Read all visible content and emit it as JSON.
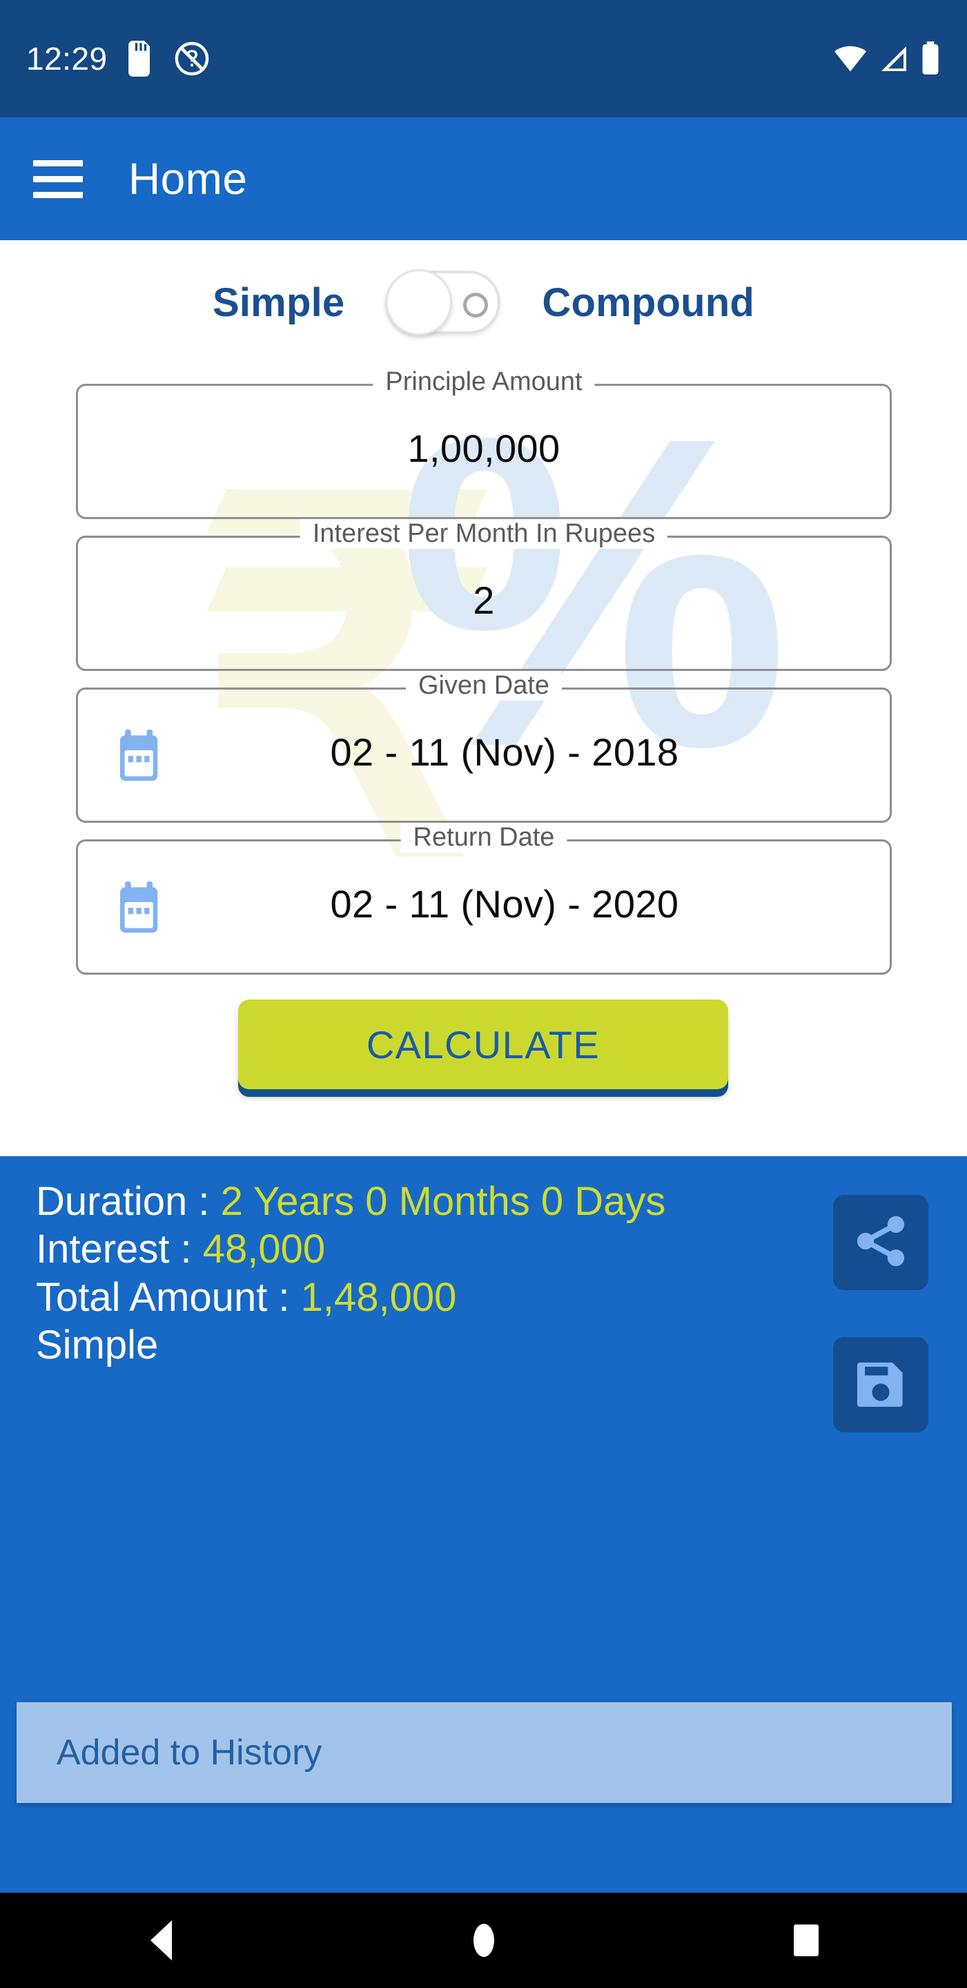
{
  "status_bar": {
    "time": "12:29",
    "icons": [
      "sd-card-icon",
      "mute-icon",
      "wifi-icon",
      "cellular-signal-icon",
      "battery-icon"
    ]
  },
  "app_bar": {
    "menu_icon": "hamburger-menu-icon",
    "title": "Home"
  },
  "mode_toggle": {
    "left_label": "Simple",
    "right_label": "Compound",
    "selected": "Simple"
  },
  "fields": {
    "principle": {
      "label": "Principle Amount",
      "value": "1,00,000"
    },
    "interest_rate": {
      "label": "Interest Per Month In Rupees",
      "value": "2"
    },
    "given_date": {
      "label": "Given Date",
      "value": "02 - 11 (Nov) - 2018",
      "icon": "calendar-icon"
    },
    "return_date": {
      "label": "Return Date",
      "value": "02 - 11 (Nov) - 2020",
      "icon": "calendar-icon"
    }
  },
  "calculate_button": {
    "label": "CALCULATE"
  },
  "results": {
    "duration_label": "Duration  : ",
    "duration_value": "2 Years 0 Months 0 Days",
    "interest_label": "Interest  : ",
    "interest_value": "48,000",
    "total_label": "Total Amount  : ",
    "total_value": "1,48,000",
    "mode": "Simple",
    "share_icon": "share-icon",
    "save_icon": "save-floppy-icon"
  },
  "snackbar": {
    "message": "Added to History"
  },
  "nav_bar": {
    "back": "back-triangle-icon",
    "home": "home-circle-icon",
    "recents": "recents-square-icon"
  },
  "watermark": {
    "rupee": "₹",
    "percent": "%"
  },
  "colors": {
    "status_bar": "#144882",
    "app_bar": "#1769c5",
    "accent_yellow": "#cbd92e",
    "result_value": "#cfdc2f",
    "snackbar_bg": "#a3c4ea",
    "snackbar_text": "#2360a3",
    "side_button_bg": "#154d91",
    "icon_blue": "#82b3f0"
  }
}
